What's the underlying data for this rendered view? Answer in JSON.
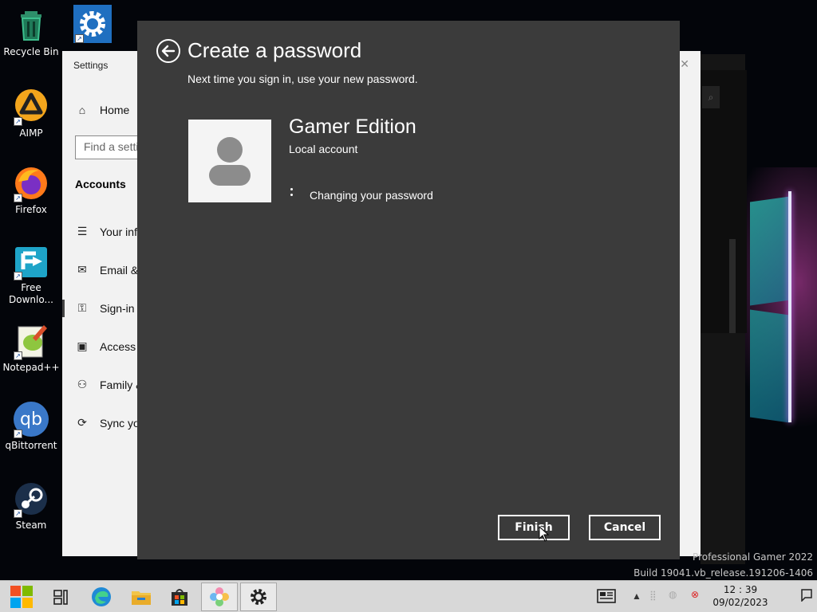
{
  "desktop": {
    "icons": [
      {
        "label": "Recycle Bin",
        "icon": "recycle-bin-icon"
      },
      {
        "label": "",
        "icon": "settings-gear-icon"
      },
      {
        "label": "AIMP",
        "icon": "aimp-icon"
      },
      {
        "label": "Firefox",
        "icon": "firefox-icon"
      },
      {
        "label": "Free\nDownlo...",
        "icon": "free-download-manager-icon"
      },
      {
        "label": "Notepad++",
        "icon": "notepadpp-icon"
      },
      {
        "label": "qBittorrent",
        "icon": "qbittorrent-icon"
      },
      {
        "label": "Steam",
        "icon": "steam-icon"
      }
    ],
    "watermark": {
      "line1": "Professional Gamer 2022",
      "line2": "Build 19041.vb_release.191206-1406"
    }
  },
  "settings_window": {
    "title": "Settings",
    "home_label": "Home",
    "search_placeholder": "Find a setti",
    "section_heading": "Accounts",
    "nav_items": [
      {
        "label": "Your inf",
        "icon": "person-list-icon"
      },
      {
        "label": "Email &",
        "icon": "email-icon"
      },
      {
        "label": "Sign-in",
        "icon": "key-icon"
      },
      {
        "label": "Access w",
        "icon": "briefcase-icon"
      },
      {
        "label": "Family &",
        "icon": "person-add-icon"
      },
      {
        "label": "Sync yo",
        "icon": "sync-icon"
      }
    ]
  },
  "dialog": {
    "title": "Create a password",
    "subtitle": "Next time you sign in, use your new password.",
    "account_name": "Gamer Edition",
    "account_type": "Local account",
    "status": "Changing your password",
    "finish_label": "Finish",
    "cancel_label": "Cancel"
  },
  "taskbar": {
    "items": [
      {
        "name": "start-button",
        "icon": "windows-logo-icon"
      },
      {
        "name": "task-view-button",
        "icon": "task-view-icon"
      },
      {
        "name": "edge-button",
        "icon": "edge-icon"
      },
      {
        "name": "file-explorer-button",
        "icon": "folder-icon"
      },
      {
        "name": "store-button",
        "icon": "store-icon"
      },
      {
        "name": "paint-app-button",
        "icon": "flower-app-icon"
      },
      {
        "name": "settings-app-button",
        "icon": "gear-icon"
      }
    ],
    "time": "12 : 39",
    "date": "09/02/2023"
  },
  "colors": {
    "dialog_bg": "#3b3b3b",
    "settings_bg": "#f2f2f2",
    "taskbar_bg": "#d8d8d8"
  }
}
